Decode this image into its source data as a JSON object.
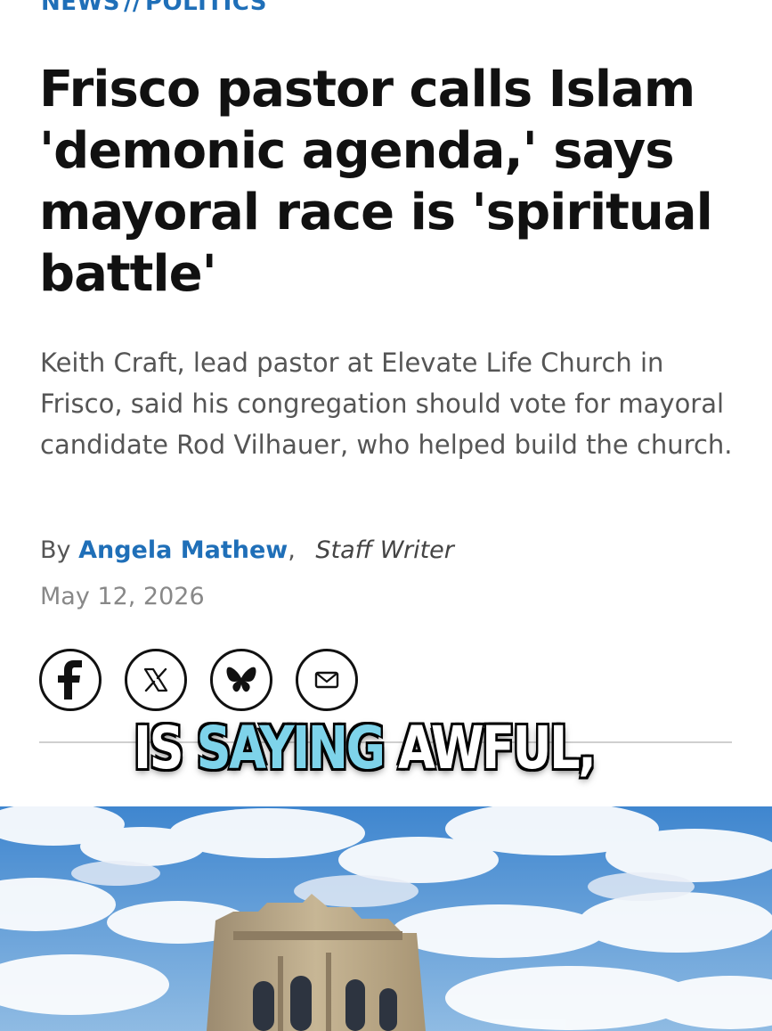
{
  "article": {
    "kicker_section": "NEWS",
    "kicker_separator": "//",
    "kicker_subsection": "POLITICS",
    "headline": "Frisco pastor calls Islam 'demonic agenda,' says mayoral race is 'spiritual battle'",
    "dek": "Keith Craft, lead pastor at Elevate Life Church in Frisco, said his congregation should vote for mayoral candidate Rod Vilhauer, who helped build the church.",
    "byline_prefix": "By",
    "author": "Angela Mathew",
    "author_separator": ",",
    "author_role": "Staff Writer",
    "date": "May 12, 2026"
  },
  "share": {
    "buttons": [
      {
        "icon": "facebook-icon"
      },
      {
        "icon": "x-icon"
      },
      {
        "icon": "bluesky-icon"
      },
      {
        "icon": "email-icon"
      }
    ]
  },
  "caption": {
    "word1": "IS",
    "word2": "SAYING",
    "word3": "AWFUL,",
    "highlight_color": "#7ed3ea"
  },
  "colors": {
    "link": "#1f6fb8",
    "headline": "#111111",
    "dek": "#555555",
    "date": "#888888"
  }
}
